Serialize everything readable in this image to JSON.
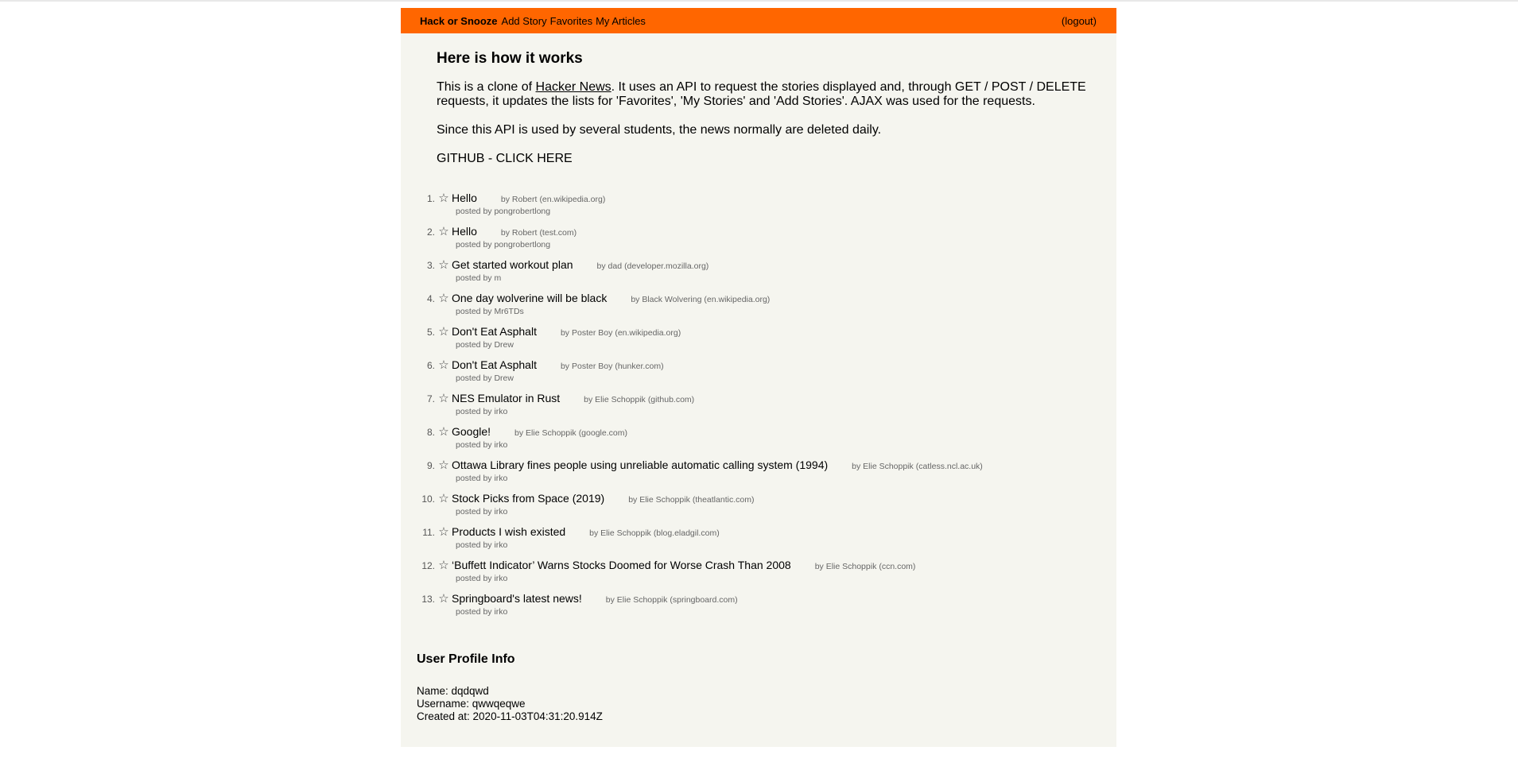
{
  "nav": {
    "brand": "Hack or Snooze",
    "links": [
      "Add Story",
      "Favorites",
      "My Articles"
    ],
    "logout": "(logout)",
    "accent": "#ff6600"
  },
  "intro": {
    "heading": "Here is how it works",
    "p1_pre": "This is a clone of",
    "p1_link": "Hacker News",
    "p1_post": ". It uses an API to request the stories displayed and, through GET / POST / DELETE requests, it updates the lists for 'Favorites', 'My Stories' and 'Add Stories'. AJAX was used for the requests.",
    "p2": "Since this API is used by several students, the news normally are deleted daily.",
    "github_label": "GITHUB -",
    "github_link": "CLICK HERE"
  },
  "stories": [
    {
      "num": "1.",
      "title": "Hello",
      "author": "by Robert",
      "host": "(en.wikipedia.org)",
      "posted": "posted by pongrobertlong"
    },
    {
      "num": "2.",
      "title": "Hello",
      "author": "by Robert",
      "host": "(test.com)",
      "posted": "posted by pongrobertlong"
    },
    {
      "num": "3.",
      "title": "Get started workout plan",
      "author": "by dad",
      "host": "(developer.mozilla.org)",
      "posted": "posted by m"
    },
    {
      "num": "4.",
      "title": "One day wolverine will be black",
      "author": "by Black Wolvering",
      "host": "(en.wikipedia.org)",
      "posted": "posted by Mr6TDs"
    },
    {
      "num": "5.",
      "title": "Don't Eat Asphalt",
      "author": "by Poster Boy",
      "host": "(en.wikipedia.org)",
      "posted": "posted by Drew"
    },
    {
      "num": "6.",
      "title": "Don't Eat Asphalt",
      "author": "by Poster Boy",
      "host": "(hunker.com)",
      "posted": "posted by Drew"
    },
    {
      "num": "7.",
      "title": "NES Emulator in Rust",
      "author": "by Elie Schoppik",
      "host": "(github.com)",
      "posted": "posted by irko"
    },
    {
      "num": "8.",
      "title": "Google!",
      "author": "by Elie Schoppik",
      "host": "(google.com)",
      "posted": "posted by irko"
    },
    {
      "num": "9.",
      "title": "Ottawa Library fines people using unreliable automatic calling system (1994)",
      "author": "by Elie Schoppik",
      "host": "(catless.ncl.ac.uk)",
      "posted": "posted by irko"
    },
    {
      "num": "10.",
      "title": "Stock Picks from Space (2019)",
      "author": "by Elie Schoppik",
      "host": "(theatlantic.com)",
      "posted": "posted by irko"
    },
    {
      "num": "11.",
      "title": "Products I wish existed",
      "author": "by Elie Schoppik",
      "host": "(blog.eladgil.com)",
      "posted": "posted by irko"
    },
    {
      "num": "12.",
      "title": "‘Buffett Indicator’ Warns Stocks Doomed for Worse Crash Than 2008",
      "author": "by Elie Schoppik",
      "host": "(ccn.com)",
      "posted": "posted by irko"
    },
    {
      "num": "13.",
      "title": "Springboard's latest news!",
      "author": "by Elie Schoppik",
      "host": "(springboard.com)",
      "posted": "posted by irko"
    }
  ],
  "profile": {
    "heading": "User Profile Info",
    "name": "Name: dqdqwd",
    "username": "Username: qwwqeqwe",
    "created": "Created at: 2020-11-03T04:31:20.914Z"
  },
  "icons": {
    "favorite": "star-outline-icon"
  }
}
